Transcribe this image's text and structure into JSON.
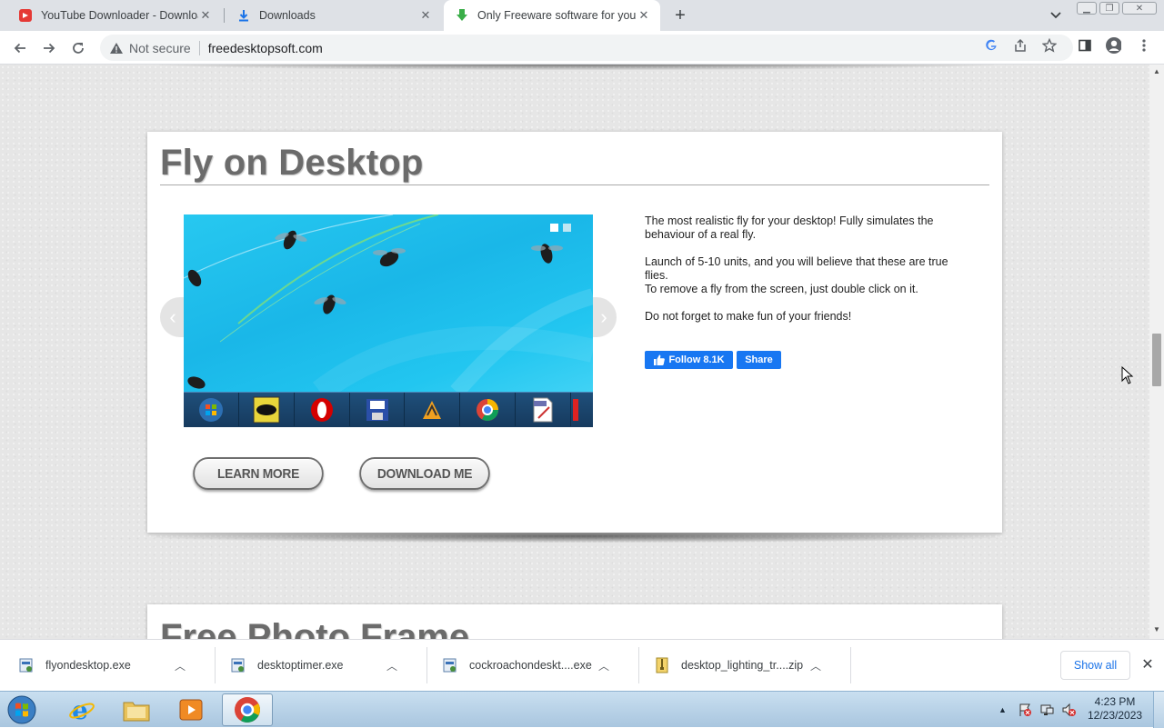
{
  "browser": {
    "tabs": [
      {
        "title": "YouTube Downloader - Download",
        "active": false
      },
      {
        "title": "Downloads",
        "active": false
      },
      {
        "title": "Only Freeware software for your",
        "active": true
      }
    ],
    "address": {
      "security_label": "Not secure",
      "url": "freedesktopsoft.com"
    }
  },
  "card": {
    "title": "Fly on Desktop",
    "description": [
      "The most realistic fly for your desktop! Fully simulates the behaviour of a real fly.",
      "Launch of 5-10 units, and you will believe that these are true flies.",
      "To remove a fly from the screen, just double click on it.",
      "Do not forget to make fun of your friends!"
    ],
    "buttons": {
      "learn_more": "LEARN MORE",
      "download": "DOWNLOAD ME"
    },
    "facebook": {
      "follow": "Follow 8.1K",
      "share": "Share"
    }
  },
  "next_card": {
    "title": "Free Photo Frame"
  },
  "downloads": {
    "items": [
      {
        "name": "flyondesktop.exe",
        "icon": "exe-installer-icon"
      },
      {
        "name": "desktoptimer.exe",
        "icon": "exe-installer-icon"
      },
      {
        "name": "cockroachondeskt....exe",
        "icon": "exe-installer-icon"
      },
      {
        "name": "desktop_lighting_tr....zip",
        "icon": "zip-archive-icon"
      }
    ],
    "show_all": "Show all"
  },
  "taskbar": {
    "time": "4:23 PM",
    "date": "12/23/2023",
    "apps": [
      "internet-explorer-icon",
      "explorer-folder-icon",
      "media-player-icon",
      "chrome-icon"
    ]
  },
  "colors": {
    "accent_link": "#1a73e8",
    "facebook_blue": "#1877f2",
    "title_gray": "#6b6b6b"
  }
}
